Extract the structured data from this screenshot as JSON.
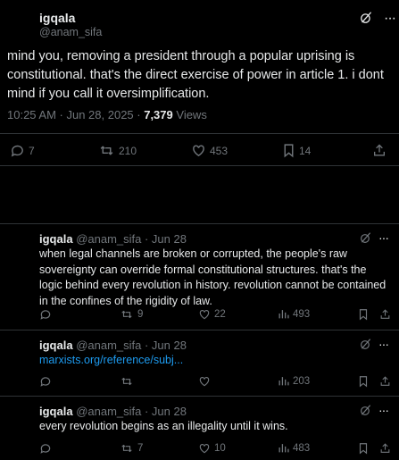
{
  "main_tweet": {
    "display_name": "igqala",
    "handle": "@anam_sifa",
    "text": "mind you, removing a president through a  popular uprising is constitutional. that's the direct exercise of power in article 1. i dont mind if you call it oversimplification.",
    "timestamp": "10:25 AM · Jun 28, 2025 · ",
    "views_count": "7,379",
    "views_label": " Views",
    "replies": "7",
    "reposts": "210",
    "likes": "453",
    "bookmarks": "14"
  },
  "replies": [
    {
      "display_name": "igqala",
      "handle_date": "@anam_sifa · Jun 28",
      "text": "when legal channels are broken or corrupted, the people's raw sovereignty can override formal constitutional structures. that's the logic behind every revolution in history. revolution cannot be contained in the confines of the rigidity of law.",
      "replies": "",
      "reposts": "9",
      "likes": "22",
      "views": "493"
    },
    {
      "display_name": "igqala",
      "handle_date": "@anam_sifa · Jun 28",
      "link": "marxists.org/reference/subj...",
      "replies": "",
      "reposts": "",
      "likes": "",
      "views": "203"
    },
    {
      "display_name": "igqala",
      "handle_date": "@anam_sifa · Jun 28",
      "text": "every revolution begins as an illegality  until it wins.",
      "replies": "",
      "reposts": "7",
      "likes": "10",
      "views": "483"
    }
  ],
  "icons": {
    "grok": "grok-icon",
    "more": "more-icon",
    "reply": "reply-icon",
    "repost": "repost-icon",
    "like": "heart-icon",
    "bookmark": "bookmark-icon",
    "share": "share-icon",
    "views": "views-icon"
  },
  "colors": {
    "background": "#000000",
    "text": "#e7e9ea",
    "muted": "#71767b",
    "link": "#1d9bf0",
    "divider": "#2f3336"
  },
  "glyphs": {
    "more": "···"
  }
}
